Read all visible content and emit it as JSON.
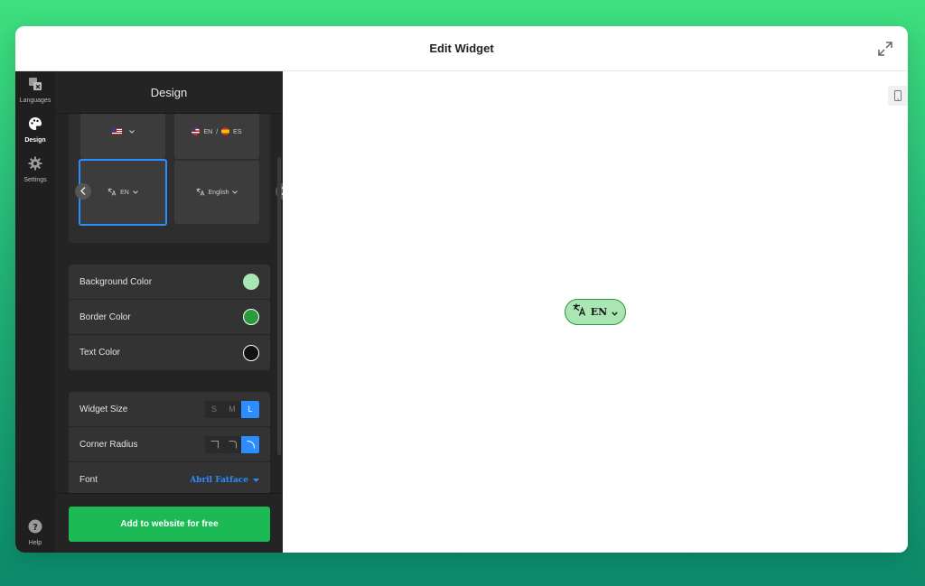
{
  "modal": {
    "title": "Edit Widget"
  },
  "rail": {
    "items": [
      {
        "label": "Languages",
        "icon": "translate-icon"
      },
      {
        "label": "Design",
        "icon": "palette-icon"
      },
      {
        "label": "Settings",
        "icon": "gear-icon"
      }
    ],
    "help": {
      "label": "Help",
      "icon": "help-icon"
    }
  },
  "panel": {
    "title": "Design",
    "styles": [
      {
        "label": "",
        "icon": "us-flag-icon"
      },
      {
        "label": "EN",
        "second_label": "ES",
        "separator": "/",
        "icon": "us-flag-icon",
        "second_icon": "es-flag-icon"
      },
      {
        "label": "EN",
        "icon": "translate-icon",
        "selected": true
      },
      {
        "label": "English",
        "icon": "translate-icon"
      }
    ],
    "colors": [
      {
        "label": "Background Color",
        "value": "#a9e6b3"
      },
      {
        "label": "Border Color",
        "value": "#2a9a3a"
      },
      {
        "label": "Text Color",
        "value": "#111111"
      }
    ],
    "widget_size": {
      "label": "Widget Size",
      "options": [
        "S",
        "M",
        "L"
      ],
      "selected": "L"
    },
    "corner_radius": {
      "label": "Corner Radius",
      "selected_index": 2
    },
    "font": {
      "label": "Font",
      "value": "Abril Fatface"
    }
  },
  "cta": {
    "label": "Add to website for free"
  },
  "preview": {
    "widget": {
      "label": "EN",
      "background": "#a9e6b3",
      "border": "#2a9a3a",
      "text": "#111111"
    }
  },
  "colors": {
    "accent": "#2d8cff",
    "cta": "#1cba55"
  }
}
